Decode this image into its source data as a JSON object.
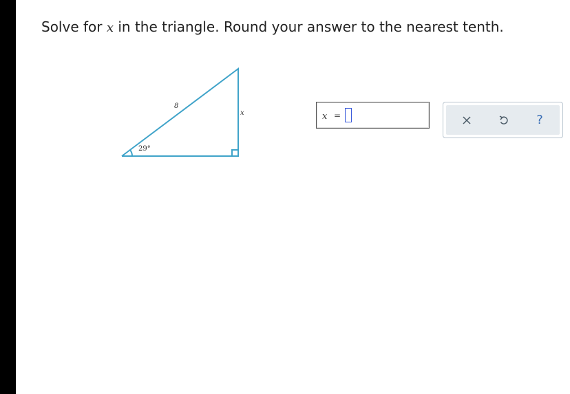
{
  "question": {
    "prefix": "Solve for ",
    "var": "x",
    "suffix": " in the triangle. Round your answer to the nearest tenth."
  },
  "figure": {
    "hypotenuse_label": "8",
    "side_label": "x",
    "angle_label": "29°",
    "line_color": "#3fa3c9"
  },
  "answer": {
    "var": "x",
    "equals": "=",
    "value": ""
  },
  "toolbar": {
    "clear_icon": "close-icon",
    "undo_icon": "undo-icon",
    "help_label": "?"
  }
}
